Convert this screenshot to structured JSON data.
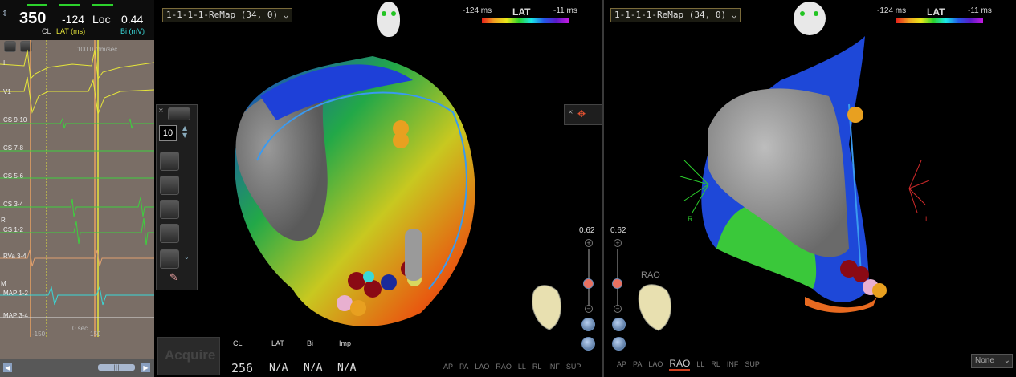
{
  "ecg_panel": {
    "cl_value": "350",
    "cl_label": "CL",
    "lat_value": "-124",
    "lat_label": "LAT (ms)",
    "loc_value": "Loc",
    "bi_value": "0.44",
    "bi_label": "Bi (mV)",
    "speed_label": "100.0 mm/sec",
    "channels": [
      "II",
      "V1",
      "CS 9-10",
      "CS 7-8",
      "CS 5-6",
      "CS 3-4",
      "CS 1-2",
      "RVa 3-4",
      "MAP 1-2",
      "MAP 3-4"
    ],
    "side_labels": [
      "R",
      "M"
    ],
    "time_labels": [
      "-150",
      "0 sec",
      "150"
    ],
    "scroll_thumb": "|||"
  },
  "left_view": {
    "map_name": "1-1-1-1-ReMap (34, 0)",
    "lat_min": "-124 ms",
    "lat_title": "LAT",
    "lat_max": "-11 ms",
    "opacity_value": "0.62",
    "views": [
      "AP",
      "PA",
      "LAO",
      "RAO",
      "LL",
      "RL",
      "INF",
      "SUP"
    ],
    "tool_count": "10",
    "acquire_label": "Acquire",
    "footer_labels": [
      "CL",
      "LAT",
      "Bi",
      "Imp"
    ],
    "footer_values": [
      "256",
      "N/A",
      "N/A",
      "N/A"
    ]
  },
  "right_view": {
    "map_name": "1-1-1-1-ReMap (34, 0)",
    "lat_min": "-124 ms",
    "lat_title": "LAT",
    "lat_max": "-11 ms",
    "opacity_value": "0.62",
    "orientation_label": "RAO",
    "views": [
      "AP",
      "PA",
      "LAO",
      "RAO",
      "LL",
      "RL",
      "INF",
      "SUP"
    ],
    "active_view": "RAO",
    "axis_labels": [
      "R",
      "L"
    ],
    "none_select": "None"
  },
  "colors": {
    "ecg_background": "#7a6e66",
    "accent_green": "#2cd12c",
    "signal_yellow": "#e6e63a",
    "signal_green": "#3ed03e",
    "signal_cyan": "#3ad8d8",
    "active_view_underline": "#d04020"
  }
}
